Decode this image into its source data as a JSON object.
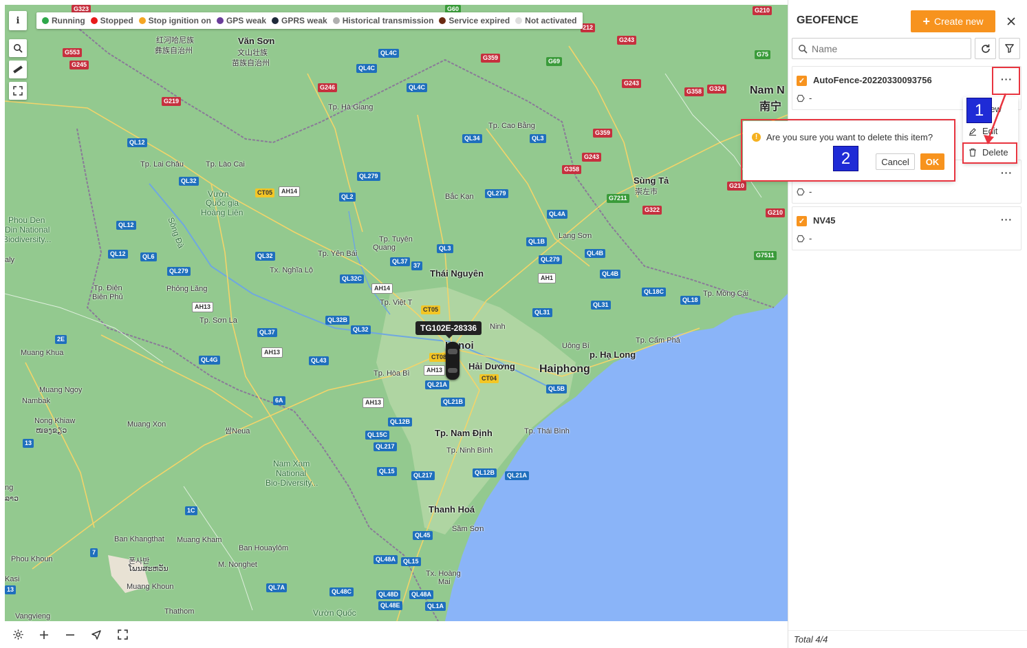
{
  "legend": [
    {
      "label": "Running",
      "color": "#2ea84a"
    },
    {
      "label": "Stopped",
      "color": "#e81a1a"
    },
    {
      "label": "Stop ignition on",
      "color": "#f5a623"
    },
    {
      "label": "GPS weak",
      "color": "#6a3d9a"
    },
    {
      "label": "GPRS weak",
      "color": "#1e2a3a"
    },
    {
      "label": "Historical transmission",
      "color": "#b0b0b0"
    },
    {
      "label": "Service expired",
      "color": "#6b2a12"
    },
    {
      "label": "Not activated",
      "color": "#dedede"
    }
  ],
  "map": {
    "info_label": "i",
    "vehicle_tag": "TG102E-28336",
    "places": {
      "van_son": "Văn Sơn",
      "van_son_cn1": "红河哈尼族",
      "van_son_cn2": "彝族自治州",
      "wenshan_cn1": "文山壮族",
      "wenshan_cn2": "苗族自治州",
      "ha_giang": "Tp. Hà Giang",
      "cao_bang": "Tp. Cao Bằng",
      "lai_chau": "Tp. Lai Châu",
      "lao_cai": "Tp. Lào Cai",
      "bac_kan": "Bắc Kạn",
      "hoang_lien1": "Vườn",
      "hoang_lien2": "Quốc gia",
      "hoang_lien3": "Hoàng Liên",
      "phou_den1": "Phou Den",
      "phou_den2": "Din National",
      "phou_den3": "Biodiversity...",
      "song_da": "Sông Đà",
      "tuyen_quang1": "Tp. Tuyên",
      "tuyen_quang2": "Quang",
      "yen_bai": "Tp. Yên Bái",
      "nghia_lo": "Tx. Nghĩa Lộ",
      "thai_nguyen": "Thái Nguyên",
      "lang_son": "Lạng Sơn",
      "sung_ta": "Sùng Tả",
      "sung_ta_cn": "崇左市",
      "nam_ninh": "Nam N",
      "nam_ninh_cn": "南宁",
      "dien_bien1": "Tp. Điện",
      "dien_bien2": "Biên Phủ",
      "phong_lang": "Phỏng Lăng",
      "son_la": "Tp. Sơn La",
      "viet_tri": "Tp. Việt T",
      "hanoi": "Hanoi",
      "bac_ninh": "Ninh",
      "mong_cai": "Tp. Móng Cái",
      "cam_pha": "Tp. Cẩm Phả",
      "ha_long": "p. Hạ Long",
      "uong_bi": "Uông Bí",
      "hai_duong": "Hải Dương",
      "haiphong": "Haiphong",
      "hoa_binh": "Tp. Hòa Bì",
      "muang_khua": "Muang Khua",
      "muang_ngoy": "Muang Ngoy",
      "nambak": "Nambak",
      "nong_khiaw": "Nong Khiaw",
      "nong_khiaw_lao": "ໜອງຂຽວ",
      "muang_xon": "Muang Xon",
      "neua": "쌈Neua",
      "nam_dinh": "Tp. Nam Định",
      "thai_binh": "Tp. Thái Bình",
      "ninh_binh": "Tp. Ninh Bình",
      "nam_xam1": "Nam Xam",
      "nam_xam2": "National",
      "nam_xam3": "Bio-Diversity...",
      "thanh_hoa": "Thanh Hoá",
      "sam_son": "Sầm Sơn",
      "ban_khangthat": "Ban Khangthat",
      "muang_kham": "Muang Kham",
      "ban_houayl": "Ban Houaylôm",
      "phou_khoun": "Phou Khoun",
      "phonsavan1": "폰사반",
      "phonsavan2": "ໂພນສະຫວັນ",
      "m_nonghet": "M. Nonghet",
      "muang_khoun": "Muang Khoun",
      "tinh_gia1": "Tx. Hoàng",
      "tinh_gia2": "Mai",
      "kasi": "Kasi",
      "vangvieng": "Vangvieng",
      "thathom": "Thathom",
      "vuon_quoc": "Vườn Quốc",
      "aly": "aly",
      "ng": "ng",
      "lao_left": "ລາວ"
    },
    "shields": {
      "g323": "G323",
      "g553": "G553",
      "g245": "G245",
      "g219": "G219",
      "g60": "G60",
      "g212": "212",
      "g210a": "G210",
      "g243a": "G243",
      "g359a": "G359",
      "g69": "G69",
      "g75": "G75",
      "g246": "G246",
      "g243b": "G243",
      "g358a": "G358",
      "g324": "G324",
      "g359b": "G359",
      "g243c": "G243",
      "g358b": "G358",
      "g210b": "G210",
      "g7211": "G7211",
      "g322": "G322",
      "g210c": "G210",
      "g7511": "G7511",
      "ql4c1": "QL4C",
      "ql4c2": "QL4C",
      "ql4c3": "QL4C",
      "ql12a": "QL12",
      "ql32a": "QL32",
      "ct05a": "CT05",
      "ah14a": "AH14",
      "ql279a": "QL279",
      "ql34": "QL34",
      "ql3a": "QL3",
      "ql2": "QL2",
      "ql279b": "QL279",
      "ql12b": "QL12",
      "ql12c": "QL12",
      "ql6": "QL6",
      "ql32b": "QL32",
      "ql279c": "QL279",
      "ql4a": "QL4A",
      "ql3b": "QL3",
      "ql1b": "QL1B",
      "ql279d": "QL279",
      "ql4b": "QL4B",
      "ql37a": "QL37",
      "ql37b": "37",
      "ah14b": "AH14",
      "ql32c": "QL32C",
      "ah1": "AH1",
      "ql4b2": "QL4B",
      "ql18c": "QL18C",
      "ah13a": "AH13",
      "ql31": "QL31",
      "ql18": "QL18",
      "ct05b": "CT05",
      "ql32b2": "QL32B",
      "ql32d": "QL32",
      "ql37c": "QL37",
      "ah13b": "AH13",
      "ql4g": "QL4G",
      "ql43": "QL43",
      "ct08": "CT08",
      "ah13c": "AH13",
      "ct04": "CT04",
      "ql5b": "QL5B",
      "r2e": "2E",
      "ql21a1": "QL21A",
      "ql21b": "QL21B",
      "ah13d": "AH13",
      "r6a": "6A",
      "ql12b2": "QL12B",
      "ql15c": "QL15C",
      "ql217a": "QL217",
      "r13a": "13",
      "ql15a": "QL15",
      "ql217b": "QL217",
      "ql12b3": "QL12B",
      "ql21a2": "QL21A",
      "r1c": "1C",
      "ql45": "QL45",
      "r7": "7",
      "ql48a": "QL48A",
      "ql15b": "QL15",
      "r13b": "13",
      "ql7a": "QL7A",
      "ql48c": "QL48C",
      "ql48d": "QL48D",
      "ql48a2": "QL48A",
      "ql48e": "QL48E",
      "ql1a": "QL1A"
    }
  },
  "panel": {
    "title": "GEOFENCE",
    "create_label": "Create new",
    "search_placeholder": "Name",
    "items": [
      {
        "name": "AutoFence-20220330093756",
        "detail": "-"
      },
      {
        "name": "",
        "detail": "-"
      },
      {
        "name": "NV45",
        "detail": "-"
      }
    ],
    "menu": {
      "view": "View",
      "edit": "Edit",
      "delete": "Delete"
    },
    "confirm": {
      "text": "Are you sure you want to delete this item?",
      "cancel": "Cancel",
      "ok": "OK"
    },
    "total": "Total 4/4"
  },
  "annotations": {
    "step1": "1",
    "step2": "2"
  }
}
